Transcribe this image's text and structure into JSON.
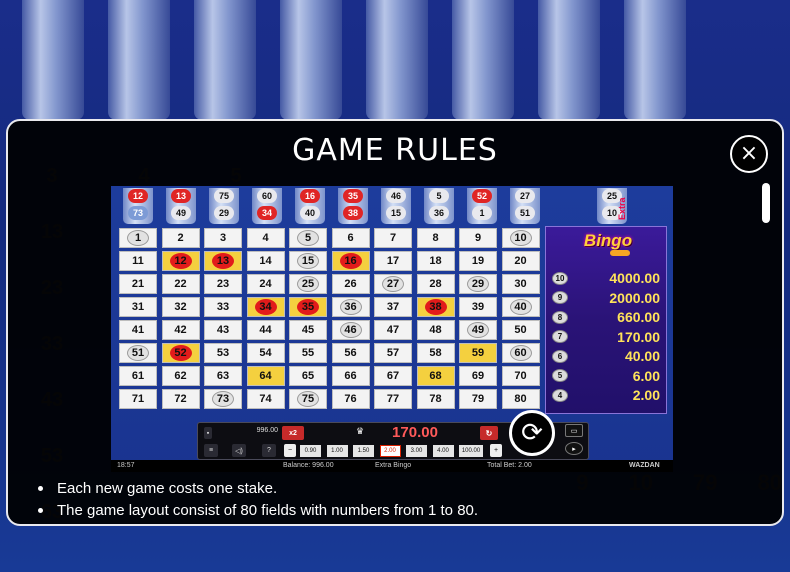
{
  "background": {
    "grid_numbers": [
      "3",
      "4",
      "5",
      "",
      "",
      "",
      "",
      "",
      "13",
      "",
      "",
      "",
      "",
      "",
      "",
      "",
      "23",
      "",
      "",
      "",
      "",
      "",
      "",
      "",
      "33",
      "",
      "",
      "",
      "",
      "",
      "",
      "",
      "43",
      "",
      "",
      "",
      "",
      "",
      "",
      "",
      "53",
      "",
      "",
      "",
      "",
      "",
      "",
      "",
      "63",
      "",
      "",
      "",
      "",
      "",
      "",
      ""
    ],
    "right_numbers": [
      "9",
      "10",
      "79",
      "80"
    ]
  },
  "modal": {
    "title": "GAME RULES",
    "close_label": "×"
  },
  "game": {
    "drawn_pairs": [
      {
        "top": "12",
        "top_c": "red",
        "bot": "73",
        "bot_c": "blue"
      },
      {
        "top": "13",
        "top_c": "red",
        "bot": "49",
        "bot_c": "white"
      },
      {
        "top": "75",
        "top_c": "white",
        "bot": "29",
        "bot_c": "white"
      },
      {
        "top": "60",
        "top_c": "white",
        "bot": "34",
        "bot_c": "red"
      },
      {
        "top": "16",
        "top_c": "red",
        "bot": "40",
        "bot_c": "white"
      },
      {
        "top": "35",
        "top_c": "red",
        "bot": "38",
        "bot_c": "red"
      },
      {
        "top": "46",
        "top_c": "white",
        "bot": "15",
        "bot_c": "white"
      },
      {
        "top": "5",
        "top_c": "white",
        "bot": "36",
        "bot_c": "white"
      },
      {
        "top": "52",
        "top_c": "red",
        "bot": "1",
        "bot_c": "white"
      },
      {
        "top": "27",
        "top_c": "white",
        "bot": "51",
        "bot_c": "white"
      },
      {
        "top": "25",
        "top_c": "white",
        "bot": "10",
        "bot_c": "white"
      }
    ],
    "board": [
      {
        "n": "1",
        "s": "white"
      },
      {
        "n": "2",
        "s": ""
      },
      {
        "n": "3",
        "s": ""
      },
      {
        "n": "4",
        "s": ""
      },
      {
        "n": "5",
        "s": "white"
      },
      {
        "n": "6",
        "s": ""
      },
      {
        "n": "7",
        "s": ""
      },
      {
        "n": "8",
        "s": ""
      },
      {
        "n": "9",
        "s": ""
      },
      {
        "n": "10",
        "s": "white"
      },
      {
        "n": "11",
        "s": ""
      },
      {
        "n": "12",
        "s": "redgold"
      },
      {
        "n": "13",
        "s": "redgold"
      },
      {
        "n": "14",
        "s": ""
      },
      {
        "n": "15",
        "s": "white"
      },
      {
        "n": "16",
        "s": "redgold"
      },
      {
        "n": "17",
        "s": ""
      },
      {
        "n": "18",
        "s": ""
      },
      {
        "n": "19",
        "s": ""
      },
      {
        "n": "20",
        "s": ""
      },
      {
        "n": "21",
        "s": ""
      },
      {
        "n": "22",
        "s": ""
      },
      {
        "n": "23",
        "s": ""
      },
      {
        "n": "24",
        "s": ""
      },
      {
        "n": "25",
        "s": "white"
      },
      {
        "n": "26",
        "s": ""
      },
      {
        "n": "27",
        "s": "white"
      },
      {
        "n": "28",
        "s": ""
      },
      {
        "n": "29",
        "s": "white"
      },
      {
        "n": "30",
        "s": ""
      },
      {
        "n": "31",
        "s": ""
      },
      {
        "n": "32",
        "s": ""
      },
      {
        "n": "33",
        "s": ""
      },
      {
        "n": "34",
        "s": "redgold"
      },
      {
        "n": "35",
        "s": "redgold"
      },
      {
        "n": "36",
        "s": "white"
      },
      {
        "n": "37",
        "s": ""
      },
      {
        "n": "38",
        "s": "redgold"
      },
      {
        "n": "39",
        "s": ""
      },
      {
        "n": "40",
        "s": "white"
      },
      {
        "n": "41",
        "s": ""
      },
      {
        "n": "42",
        "s": ""
      },
      {
        "n": "43",
        "s": ""
      },
      {
        "n": "44",
        "s": ""
      },
      {
        "n": "45",
        "s": ""
      },
      {
        "n": "46",
        "s": "white"
      },
      {
        "n": "47",
        "s": ""
      },
      {
        "n": "48",
        "s": ""
      },
      {
        "n": "49",
        "s": "white"
      },
      {
        "n": "50",
        "s": ""
      },
      {
        "n": "51",
        "s": "white"
      },
      {
        "n": "52",
        "s": "redgold"
      },
      {
        "n": "53",
        "s": ""
      },
      {
        "n": "54",
        "s": ""
      },
      {
        "n": "55",
        "s": ""
      },
      {
        "n": "56",
        "s": ""
      },
      {
        "n": "57",
        "s": ""
      },
      {
        "n": "58",
        "s": ""
      },
      {
        "n": "59",
        "s": "gold"
      },
      {
        "n": "60",
        "s": "white"
      },
      {
        "n": "61",
        "s": ""
      },
      {
        "n": "62",
        "s": ""
      },
      {
        "n": "63",
        "s": ""
      },
      {
        "n": "64",
        "s": "gold"
      },
      {
        "n": "65",
        "s": ""
      },
      {
        "n": "66",
        "s": ""
      },
      {
        "n": "67",
        "s": ""
      },
      {
        "n": "68",
        "s": "gold"
      },
      {
        "n": "69",
        "s": ""
      },
      {
        "n": "70",
        "s": ""
      },
      {
        "n": "71",
        "s": ""
      },
      {
        "n": "72",
        "s": ""
      },
      {
        "n": "73",
        "s": "white"
      },
      {
        "n": "74",
        "s": ""
      },
      {
        "n": "75",
        "s": "white"
      },
      {
        "n": "76",
        "s": ""
      },
      {
        "n": "77",
        "s": ""
      },
      {
        "n": "78",
        "s": ""
      },
      {
        "n": "79",
        "s": ""
      },
      {
        "n": "80",
        "s": ""
      }
    ],
    "logo_text": "Bingo",
    "extra_label": "Extra",
    "paytable": [
      {
        "hits": "10",
        "value": "4000.00"
      },
      {
        "hits": "9",
        "value": "2000.00"
      },
      {
        "hits": "8",
        "value": "660.00"
      },
      {
        "hits": "7",
        "value": "170.00"
      },
      {
        "hits": "6",
        "value": "40.00"
      },
      {
        "hits": "5",
        "value": "6.00"
      },
      {
        "hits": "4",
        "value": "2.00"
      }
    ],
    "controls": {
      "balance_value": "996.00",
      "x2_label": "x2",
      "win_value": "170.00",
      "menu_label": "≡",
      "sound_label": "◁)",
      "help_label": "?",
      "minus_label": "−",
      "plus_label": "+",
      "stakes": [
        "0.90",
        "1.00",
        "1.50",
        "2.00",
        "3.00",
        "4.00",
        "100.00"
      ],
      "selected_stake": "2.00",
      "spin_icon": "⟳"
    },
    "status": {
      "time": "18:57",
      "balance": "Balance: 996.00",
      "game_name": "Extra Bingo",
      "total_bet": "Total Bet: 2.00",
      "brand": "WAZDAN"
    }
  },
  "rules": [
    "Each new game costs one stake.",
    "The game layout consist of 80 fields with numbers from 1 to 80."
  ]
}
